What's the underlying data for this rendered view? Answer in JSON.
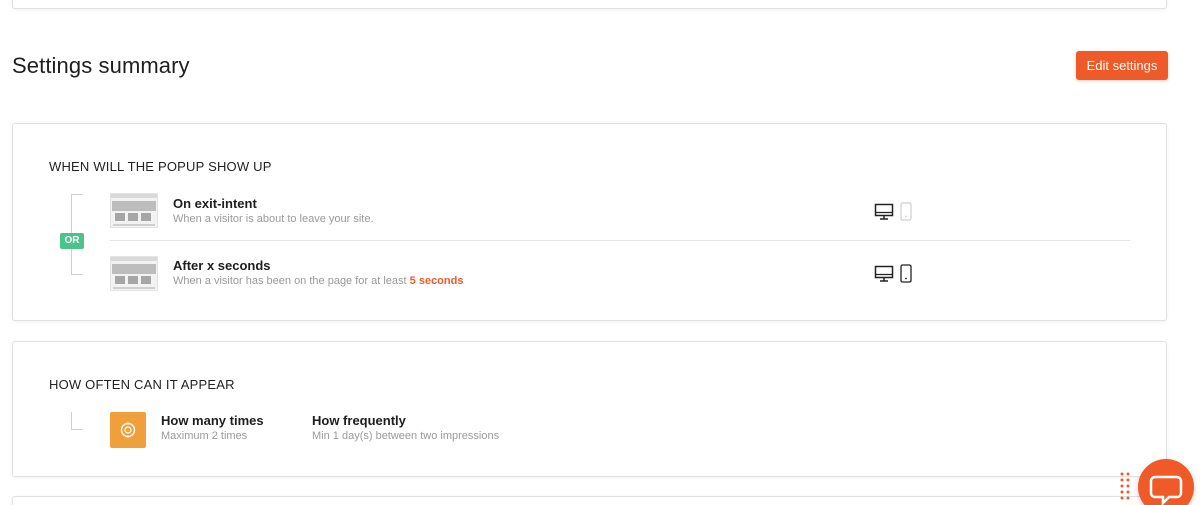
{
  "page": {
    "title": "Settings summary",
    "edit_button": "Edit settings"
  },
  "when_section": {
    "title": "WHEN WILL THE POPUP SHOW UP",
    "or_label": "OR",
    "rows": [
      {
        "title": "On exit-intent",
        "description": "When a visitor is about to leave your site.",
        "desktop_active": true,
        "mobile_active": false
      },
      {
        "title": "After x seconds",
        "description": "When a visitor has been on the page for at least",
        "highlight": "5 seconds",
        "desktop_active": true,
        "mobile_active": true
      }
    ]
  },
  "often_section": {
    "title": "HOW OFTEN CAN IT APPEAR",
    "how_many_title": "How many times",
    "how_many_desc": "Maximum 2 times",
    "frequency_title": "How frequently",
    "frequency_desc": "Min 1 day(s) between two impressions"
  },
  "colors": {
    "accent": "#f05a28",
    "or_badge": "#4cc38a",
    "frequency_icon": "#f0a03a"
  }
}
